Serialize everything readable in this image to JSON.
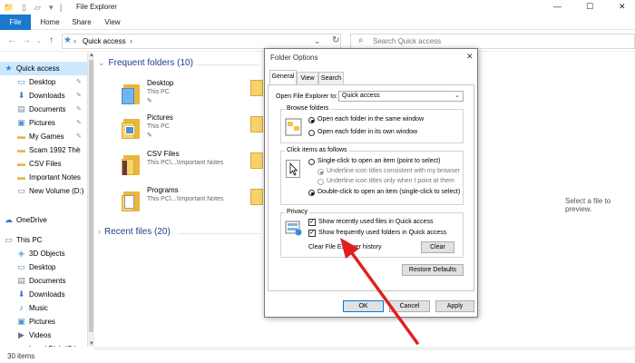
{
  "titlebar": {
    "title": "File Explorer",
    "minimize": "—",
    "maximize": "☐",
    "close": "✕"
  },
  "ribbon": {
    "tabs": [
      "File",
      "Home",
      "Share",
      "View"
    ]
  },
  "address": {
    "location": "Quick access",
    "search_placeholder": "Search Quick access"
  },
  "nav": {
    "items": [
      {
        "label": "Quick access",
        "icon": "star-icon",
        "pinned": false,
        "selected": true
      },
      {
        "label": "Desktop",
        "icon": "desktop-folder-icon",
        "pinned": true
      },
      {
        "label": "Downloads",
        "icon": "downloads-icon",
        "pinned": true
      },
      {
        "label": "Documents",
        "icon": "documents-icon",
        "pinned": true
      },
      {
        "label": "Pictures",
        "icon": "pictures-icon",
        "pinned": true
      },
      {
        "label": "My Games",
        "icon": "folder-icon",
        "pinned": true
      },
      {
        "label": "Scam 1992 The",
        "icon": "folder-icon",
        "pinned": true
      },
      {
        "label": "CSV Files",
        "icon": "folder-icon",
        "pinned": false
      },
      {
        "label": "Important Notes",
        "icon": "folder-icon",
        "pinned": false
      },
      {
        "label": "New Volume (D:)",
        "icon": "drive-icon",
        "pinned": false
      },
      {
        "label": "OneDrive",
        "icon": "cloud-icon",
        "pinned": false
      },
      {
        "label": "This PC",
        "icon": "computer-icon",
        "pinned": false
      },
      {
        "label": "3D Objects",
        "icon": "3d-objects-icon",
        "pinned": false
      },
      {
        "label": "Desktop",
        "icon": "desktop-folder-icon",
        "pinned": false
      },
      {
        "label": "Documents",
        "icon": "documents-icon",
        "pinned": false
      },
      {
        "label": "Downloads",
        "icon": "downloads-icon",
        "pinned": false
      },
      {
        "label": "Music",
        "icon": "music-icon",
        "pinned": false
      },
      {
        "label": "Pictures",
        "icon": "pictures-icon",
        "pinned": false
      },
      {
        "label": "Videos",
        "icon": "videos-icon",
        "pinned": false
      },
      {
        "label": "Local Disk (C:)",
        "icon": "drive-icon",
        "pinned": false
      }
    ]
  },
  "content": {
    "frequent_header": "Frequent folders (10)",
    "recent_header": "Recent files (20)",
    "folders": [
      {
        "name": "Desktop",
        "path": "This PC",
        "type": "desktop"
      },
      {
        "name": "Pictures",
        "path": "This PC",
        "type": "pictures"
      },
      {
        "name": "CSV Files",
        "path": "This PC\\...\\Important Notes",
        "type": "csv"
      },
      {
        "name": "Programs",
        "path": "This PC\\...\\Important Notes",
        "type": "programs"
      }
    ],
    "preview_text": "Select a file to preview."
  },
  "status": {
    "items": "30 items"
  },
  "dialog": {
    "title": "Folder Options",
    "tabs": [
      "General",
      "View",
      "Search"
    ],
    "open_label": "Open File Explorer to:",
    "open_value": "Quick access",
    "browse": {
      "caption": "Browse folders",
      "opt1": "Open each folder in the same window",
      "opt2": "Open each folder in its own window"
    },
    "click": {
      "caption": "Click items as follows",
      "opt1": "Single-click to open an item (point to select)",
      "sub1": "Underline icon titles consistent with my browser",
      "sub2": "Underline icon titles only when I point at them",
      "opt2": "Double-click to open an item (single-click to select)"
    },
    "privacy": {
      "caption": "Privacy",
      "chk1": "Show recently used files in Quick access",
      "chk2": "Show frequently used folders in Quick access",
      "clear_label": "Clear File Explorer history",
      "clear_btn": "Clear"
    },
    "restore": "Restore Defaults",
    "ok": "OK",
    "cancel": "Cancel",
    "apply": "Apply"
  },
  "colors": {
    "accent": "#1979ca",
    "selection": "#cce8ff",
    "annotation_arrow": "#e02020"
  }
}
